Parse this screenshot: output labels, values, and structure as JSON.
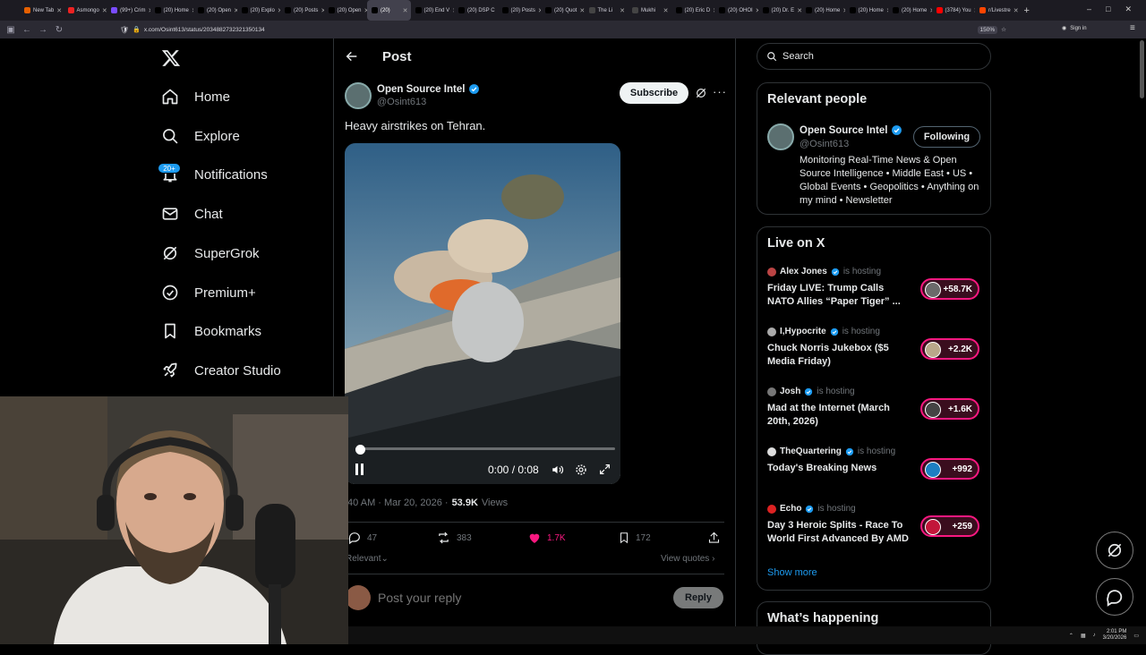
{
  "browser": {
    "tabs": [
      {
        "label": "New Tab",
        "favicon_color": "#e66000",
        "active": false
      },
      {
        "label": "Asmongo",
        "favicon_color": "#e22",
        "active": false
      },
      {
        "label": "(99+) Crim",
        "favicon_color": "#7a4cff",
        "active": false
      },
      {
        "label": "(20) Home",
        "favicon_color": "#000",
        "active": false
      },
      {
        "label": "(20) Open",
        "favicon_color": "#000",
        "active": false
      },
      {
        "label": "(20) Explo",
        "favicon_color": "#000",
        "active": false
      },
      {
        "label": "(20) Posts",
        "favicon_color": "#000",
        "active": false
      },
      {
        "label": "(20) Open",
        "favicon_color": "#000",
        "active": false
      },
      {
        "label": "(20)",
        "favicon_color": "#000",
        "active": true
      },
      {
        "label": "(20) End V",
        "favicon_color": "#000",
        "active": false
      },
      {
        "label": "(20) DSP C",
        "favicon_color": "#000",
        "active": false
      },
      {
        "label": "(20) Posts",
        "favicon_color": "#000",
        "active": false
      },
      {
        "label": "(20) Quot",
        "favicon_color": "#000",
        "active": false
      },
      {
        "label": "The Li",
        "favicon_color": "#444",
        "active": false
      },
      {
        "label": "Mukhi",
        "favicon_color": "#444",
        "active": false
      },
      {
        "label": "(20) Eric D",
        "favicon_color": "#000",
        "active": false
      },
      {
        "label": "(20) OHOI",
        "favicon_color": "#000",
        "active": false
      },
      {
        "label": "(20) Dr. E",
        "favicon_color": "#000",
        "active": false
      },
      {
        "label": "(20) Home",
        "favicon_color": "#000",
        "active": false
      },
      {
        "label": "(20) Home",
        "favicon_color": "#000",
        "active": false
      },
      {
        "label": "(20) Home",
        "favicon_color": "#000",
        "active": false
      },
      {
        "label": "(3784) You",
        "favicon_color": "#f00",
        "active": false
      },
      {
        "label": "r/Livestre",
        "favicon_color": "#ff4500",
        "active": false
      }
    ],
    "url": "x.com/Osint613/status/2034882732321350134",
    "zoom": "150%",
    "sign_in": "Sign in"
  },
  "nav": {
    "items": [
      {
        "label": "Home",
        "icon": "home-icon"
      },
      {
        "label": "Explore",
        "icon": "search-icon"
      },
      {
        "label": "Notifications",
        "icon": "bell-icon"
      },
      {
        "label": "Chat",
        "icon": "mail-icon"
      },
      {
        "label": "SuperGrok",
        "icon": "grok-icon"
      },
      {
        "label": "Premium+",
        "icon": "verified-icon"
      },
      {
        "label": "Bookmarks",
        "icon": "bookmark-icon"
      },
      {
        "label": "Creator Studio",
        "icon": "rocket-icon"
      }
    ],
    "notification_badge": "20+"
  },
  "post": {
    "header_title": "Post",
    "author_name": "Open Source Intel",
    "author_handle": "@Osint613",
    "subscribe_label": "Subscribe",
    "text": "Heavy airstrikes on Tehran.",
    "video": {
      "time": "0:00 / 0:08",
      "progress": 0.02
    },
    "meta_time": ":40 AM · Mar 20, 2026 ·",
    "views_count": "53.9K",
    "views_label": "Views",
    "replies": "47",
    "reposts": "383",
    "likes": "1.7K",
    "bookmarks": "172",
    "sort_label": "Relevant",
    "view_quotes": "View quotes",
    "reply_placeholder": "Post your reply",
    "reply_button": "Reply"
  },
  "sidebar": {
    "search_placeholder": "Search",
    "relevant_people": {
      "title": "Relevant people",
      "name": "Open Source Intel",
      "handle": "@Osint613",
      "follow_label": "Following",
      "bio": "Monitoring Real-Time News & Open Source Intelligence • Middle East • US • Global Events • Geopolitics • Anything on my mind • Newsletter"
    },
    "live": {
      "title": "Live on X",
      "items": [
        {
          "host": "Alex Jones",
          "status": "is hosting",
          "title": "Friday LIVE: Trump Calls NATO Allies “Paper Tiger” ...",
          "count": "+58.7K"
        },
        {
          "host": "I,Hypocrite",
          "status": "is hosting",
          "title": "Chuck Norris Jukebox ($5 Media Friday)",
          "count": "+2.2K"
        },
        {
          "host": "Josh",
          "status": "is hosting",
          "title": "Mad at the Internet (March 20th, 2026)",
          "count": "+1.6K"
        },
        {
          "host": "TheQuartering",
          "status": "is hosting",
          "title": "Today's Breaking News",
          "count": "+992"
        },
        {
          "host": "Echo",
          "status": "is hosting",
          "title": "Day 3 Heroic Splits - Race To World First Advanced By AMD",
          "count": "+259"
        }
      ],
      "show_more": "Show more"
    },
    "whats_happening": "What’s happening"
  },
  "taskbar": {
    "time": "2:01 PM",
    "date": "3/20/2026"
  },
  "colors": {
    "accent": "#1d9bf0",
    "like": "#f91880",
    "border": "#2f3336",
    "muted": "#71767b"
  }
}
